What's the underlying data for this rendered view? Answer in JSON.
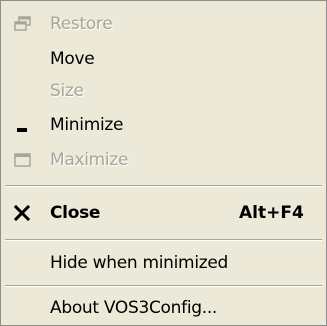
{
  "menu": {
    "items": [
      {
        "label": "Restore",
        "enabled": false,
        "icon": "restore-icon"
      },
      {
        "label": "Move",
        "enabled": true
      },
      {
        "label": "Size",
        "enabled": false
      },
      {
        "label": "Minimize",
        "enabled": true,
        "icon": "minimize-icon"
      },
      {
        "label": "Maximize",
        "enabled": false,
        "icon": "maximize-icon"
      },
      {
        "label": "Close",
        "enabled": true,
        "bold": true,
        "shortcut": "Alt+F4",
        "icon": "close-icon"
      },
      {
        "label": "Hide when minimized",
        "enabled": true
      },
      {
        "label": "About VOS3Config...",
        "enabled": true
      }
    ]
  },
  "colors": {
    "menu_background": "#ece9d8",
    "disabled_text": "#a8a699",
    "separator": "#a7a699",
    "text": "#000000"
  }
}
